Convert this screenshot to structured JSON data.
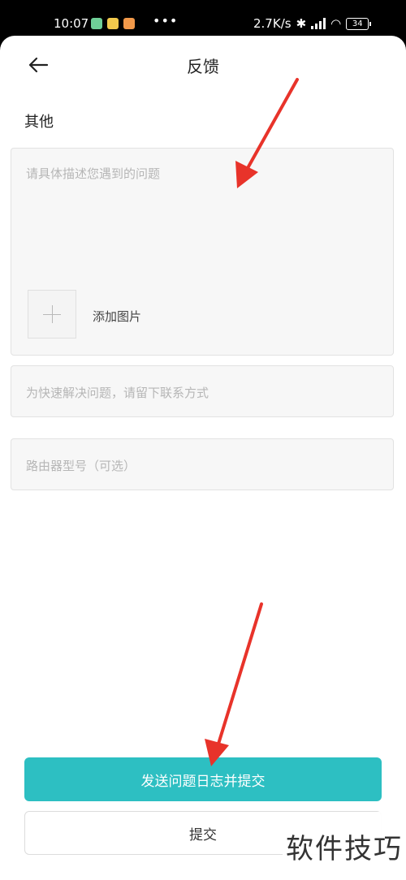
{
  "status_bar": {
    "time": "10:07",
    "net_speed": "2.7K/s",
    "battery": "34",
    "overflow_dots": "•••"
  },
  "header": {
    "title": "反馈",
    "back_icon": "arrow-left-icon"
  },
  "form": {
    "category_label": "其他",
    "description_placeholder": "请具体描述您遇到的问题",
    "add_image_label": "添加图片",
    "contact_placeholder": "为快速解决问题，请留下联系方式",
    "router_model_placeholder": "路由器型号（可选）"
  },
  "actions": {
    "send_log_submit_label": "发送问题日志并提交",
    "submit_label": "提交"
  },
  "watermark": "软件技巧",
  "colors": {
    "accent": "#2dbfc2",
    "annotation_arrow": "#e8332a"
  }
}
